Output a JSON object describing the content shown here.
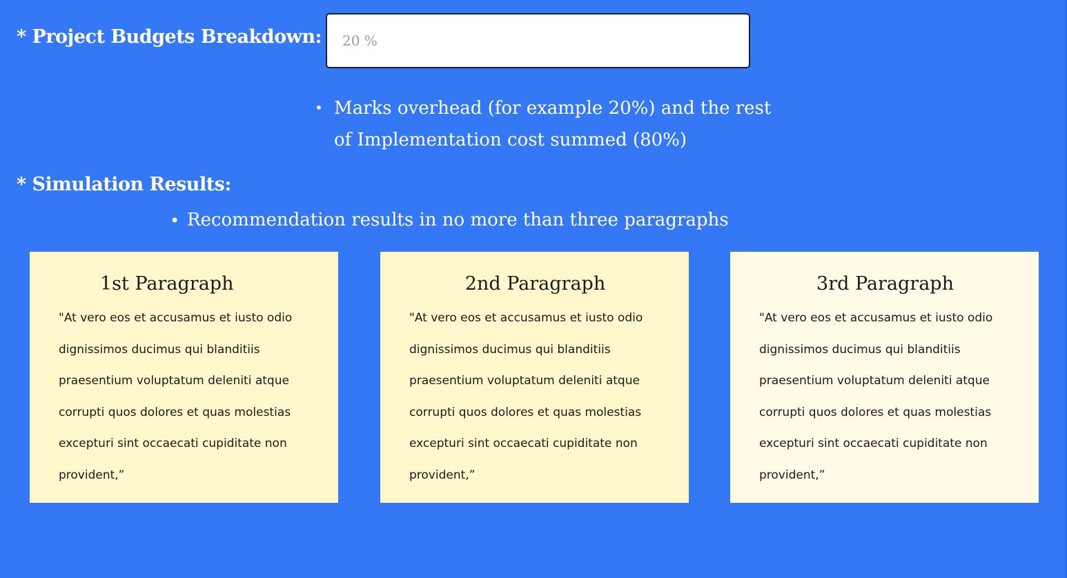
{
  "budget": {
    "label": "* Project Budgets Breakdown:",
    "input_value": "",
    "input_placeholder": "20 %",
    "hint": "Marks overhead (for example 20%) and the rest of Implementation cost summed (80%)"
  },
  "simulation": {
    "label": "* Simulation Results:",
    "hint": "Recommendation results in no more than three paragraphs"
  },
  "paragraphs": [
    {
      "title": "1st Paragraph",
      "body": "\"At vero eos et accusamus et iusto odio dignissimos ducimus qui blanditiis praesentium voluptatum deleniti atque corrupti quos dolores et quas molestias excepturi sint occaecati cupiditate non provident,”"
    },
    {
      "title": "2nd Paragraph",
      "body": "\"At vero eos et accusamus et iusto odio dignissimos ducimus qui blanditiis praesentium voluptatum deleniti atque corrupti quos dolores et quas molestias excepturi sint occaecati cupiditate non provident,”"
    },
    {
      "title": "3rd Paragraph",
      "body": "\"At vero eos et accusamus et iusto odio dignissimos ducimus qui blanditiis praesentium voluptatum deleniti atque corrupti quos dolores et quas molestias excepturi sint occaecati cupiditate non provident,”"
    }
  ],
  "colors": {
    "background": "#3478f6",
    "card": "#fff8cc",
    "card_light": "#fffbe6",
    "text_light": "#ffffff",
    "text_dark": "#1a1a1a"
  }
}
